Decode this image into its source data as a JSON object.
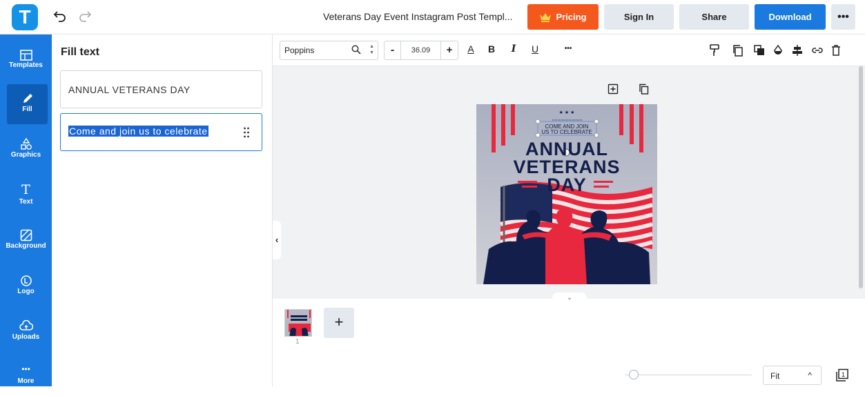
{
  "header": {
    "logo_letter": "T",
    "doc_title": "Veterans Day Event Instagram Post Templ...",
    "pricing_label": "Pricing",
    "signin_label": "Sign In",
    "share_label": "Share",
    "download_label": "Download",
    "more_label": "•••"
  },
  "sidebar": {
    "items": [
      {
        "label": "Templates",
        "icon": "templates-icon"
      },
      {
        "label": "Fill",
        "icon": "pencil-icon"
      },
      {
        "label": "Graphics",
        "icon": "shapes-icon"
      },
      {
        "label": "Text",
        "icon": "text-icon"
      },
      {
        "label": "Background",
        "icon": "background-icon"
      },
      {
        "label": "Logo",
        "icon": "logo-icon"
      },
      {
        "label": "Uploads",
        "icon": "upload-cloud-icon"
      },
      {
        "label": "More",
        "icon": "more-icon"
      }
    ]
  },
  "fill_panel": {
    "title": "Fill text",
    "fields": [
      {
        "value": "ANNUAL VETERANS DAY"
      },
      {
        "value": "Come and join us to celebrate"
      }
    ]
  },
  "toolbar": {
    "font_name": "Poppins",
    "font_size": "36.09",
    "minus": "-",
    "plus": "+",
    "bold": "B",
    "italic": "I",
    "underline": "U",
    "color_letter": "A",
    "more": "•••"
  },
  "poster": {
    "stars": "★ ★ ★",
    "subtitle_line1": "COME AND JOIN",
    "subtitle_line2": "US TO CELEBRATE",
    "title_line1": "ANNUAL",
    "title_line2": "VETERANS",
    "title_line3": "DAY"
  },
  "pages": {
    "add_label": "+",
    "page_number": "1"
  },
  "zoom": {
    "label": "Fit",
    "caret": "^"
  },
  "colors": {
    "brand_blue": "#1a7ae0",
    "pricing_orange": "#f4581d",
    "poster_red": "#e8283f",
    "poster_navy": "#131f4a"
  }
}
